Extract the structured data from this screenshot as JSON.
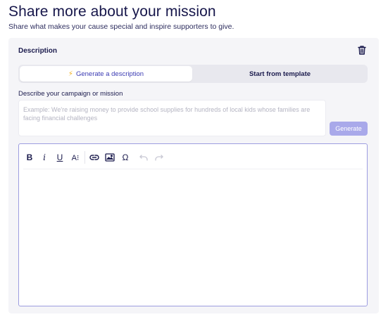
{
  "page": {
    "title": "Share more about your mission",
    "subtitle": "Share what makes your cause special and inspire supporters to give."
  },
  "card": {
    "header_label": "Description",
    "delete_icon": "trash-icon"
  },
  "toggle": {
    "generate_label": "Generate a description",
    "generate_icon": "lightning-bolt-icon",
    "template_label": "Start from template",
    "selected": "Generate a description"
  },
  "describe": {
    "label": "Describe your campaign or mission",
    "value": "",
    "placeholder": "Example: We're raising money to provide school supplies for hundreds of local kids whose families are facing financial challenges",
    "generate_button": "Generate"
  },
  "editor": {
    "toolbar": {
      "bold": "B",
      "italic": "i",
      "underline": "U",
      "text_size": "A⁝",
      "link_icon": "link-icon",
      "image_icon": "image-icon",
      "special_char": "Ω",
      "undo_icon": "undo-icon",
      "redo_icon": "redo-icon"
    },
    "content": ""
  },
  "colors": {
    "title": "#16164a",
    "accent": "#3b3bb3",
    "button_disabled": "#a9a9ea",
    "editor_border": "#9d9de0",
    "bolt": "#f2b01e",
    "card_bg": "#f5f5f8"
  }
}
